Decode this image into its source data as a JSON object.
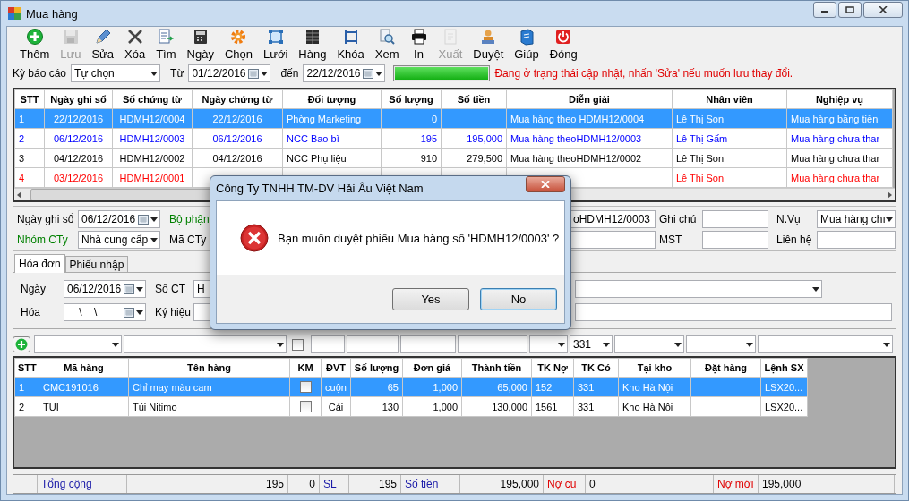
{
  "window": {
    "title": "Mua hàng"
  },
  "toolbar": [
    {
      "kind": "add",
      "label": "Thêm",
      "disabled": false
    },
    {
      "kind": "save",
      "label": "Lưu",
      "disabled": true
    },
    {
      "kind": "edit",
      "label": "Sửa",
      "disabled": false
    },
    {
      "kind": "delete",
      "label": "Xóa",
      "disabled": false
    },
    {
      "kind": "find",
      "label": "Tìm",
      "disabled": false
    },
    {
      "kind": "date",
      "label": "Ngày",
      "disabled": false
    },
    {
      "kind": "select",
      "label": "Chọn",
      "disabled": false
    },
    {
      "kind": "grid",
      "label": "Lưới",
      "disabled": false
    },
    {
      "kind": "items",
      "label": "Hàng",
      "disabled": false
    },
    {
      "kind": "lock",
      "label": "Khóa",
      "disabled": false
    },
    {
      "kind": "view",
      "label": "Xem",
      "disabled": false
    },
    {
      "kind": "print",
      "label": "In",
      "disabled": false
    },
    {
      "kind": "export",
      "label": "Xuất",
      "disabled": true
    },
    {
      "kind": "approve",
      "label": "Duyệt",
      "disabled": false
    },
    {
      "kind": "help",
      "label": "Giúp",
      "disabled": false
    },
    {
      "kind": "close",
      "label": "Đóng",
      "disabled": false
    }
  ],
  "filter": {
    "period_label": "Kỳ báo cáo",
    "period": "Tự chọn",
    "from_label": "Từ",
    "from": "01/12/2016",
    "to_label": "đến",
    "to": "22/12/2016",
    "progress": {
      "level": 1
    },
    "status_message": "Đang ở trạng thái cập nhật, nhấn 'Sửa' nếu muốn lưu thay đổi."
  },
  "documents": {
    "columns": [
      "STT",
      "Ngày ghi sổ",
      "Số chứng từ",
      "Ngày chứng từ",
      "Đối tượng",
      "Số lượng",
      "Số tiền",
      "Diễn giải",
      "Nhân viên",
      "Nghiệp vụ"
    ],
    "rows": [
      {
        "selected": true,
        "cells": [
          "1",
          "22/12/2016",
          "HDMH12/0004",
          "22/12/2016",
          "Phòng Marketing",
          "0",
          null,
          "Mua hàng theo HDMH12/0004",
          "Lê Thị Son",
          "Mua hàng bằng tiền"
        ]
      },
      {
        "selected": false,
        "color": "#0000ff",
        "cells": [
          "2",
          "06/12/2016",
          "HDMH12/0003",
          "06/12/2016",
          "NCC Bao bì",
          "195",
          "195,000",
          "Mua hàng theoHDMH12/0003",
          "Lê Thị Gấm",
          "Mua hàng chưa thar"
        ]
      },
      {
        "selected": false,
        "color": "#000000",
        "cells": [
          "3",
          "04/12/2016",
          "HDMH12/0002",
          "04/12/2016",
          "NCC Phụ liệu",
          "910",
          "279,500",
          "Mua hàng theoHDMH12/0002",
          "Lê Thị Son",
          "Mua hàng chưa thar"
        ]
      },
      {
        "selected": false,
        "color": "#ff0000",
        "cells": [
          "4",
          "03/12/2016",
          "HDMH12/0001",
          null,
          null,
          null,
          null,
          null,
          "Lê Thị Son",
          "Mua hàng chưa thar"
        ]
      }
    ]
  },
  "form": {
    "rows": [
      [
        {
          "kind": "label",
          "text": "Ngày ghi sổ",
          "color": "#000000"
        },
        {
          "kind": "date",
          "value": "06/12/2016"
        },
        {
          "kind": "label",
          "text": "Bộ phận",
          "color": "#008000"
        },
        {
          "kind": "field",
          "value": "oHDMH12/0003"
        },
        {
          "kind": "label",
          "text": "Ghi chú",
          "color": "#000000"
        },
        {
          "kind": "field"
        },
        {
          "kind": "label",
          "text": "N.Vụ",
          "color": "#000000"
        },
        {
          "kind": "combo",
          "value": "Mua hàng chı"
        }
      ],
      [
        {
          "kind": "label",
          "text": "Nhóm CTy",
          "color": "#008000"
        },
        {
          "kind": "combo",
          "value": "Nhà cung cấp"
        },
        {
          "kind": "label",
          "text": "Mã CTy",
          "color": "#000000"
        },
        {
          "kind": "field"
        },
        {
          "kind": "label",
          "text": "MST",
          "color": "#000000"
        },
        {
          "kind": "field"
        },
        {
          "kind": "label",
          "text": "Liên hệ",
          "color": "#000000"
        },
        {
          "kind": "field"
        }
      ]
    ]
  },
  "tabs": [
    {
      "label": "Hóa đơn",
      "selected": true
    },
    {
      "label": "Phiếu nhập",
      "selected": false
    }
  ],
  "invoice": {
    "rows": [
      [
        {
          "kind": "label",
          "text": "Ngày",
          "color": "#000000"
        },
        {
          "kind": "date",
          "value": "06/12/2016"
        },
        {
          "kind": "label",
          "text": "Số CT",
          "color": "#000000"
        },
        {
          "kind": "field",
          "value": "H"
        },
        {
          "kind": "combo"
        }
      ],
      [
        {
          "kind": "label",
          "text": "Hóa",
          "color": "#000000"
        },
        {
          "kind": "date",
          "value": "__\\__\\____"
        },
        {
          "kind": "label",
          "text": "Ký hiệu",
          "color": "#000000"
        },
        {
          "kind": "field"
        },
        {
          "kind": "field"
        }
      ]
    ]
  },
  "entry": {
    "checked": false,
    "account": "331"
  },
  "lines": {
    "columns": [
      "STT",
      "Mã hàng",
      "Tên hàng",
      "KM",
      "ĐVT",
      "Số lượng",
      "Đơn giá",
      "Thành tiền",
      "TK Nợ",
      "TK Có",
      "Tại kho",
      "Đặt hàng",
      "Lệnh SX"
    ],
    "rows": [
      {
        "selected": true,
        "km": false,
        "cells": [
          "1",
          "CMC191016",
          "Chỉ may màu cam",
          null,
          "cuộn",
          "65",
          "1,000",
          "65,000",
          "152",
          "331",
          "Kho Hà Nội",
          null,
          "LSX20..."
        ]
      },
      {
        "selected": false,
        "km": false,
        "cells": [
          "2",
          "TUI",
          "Túi Nitimo",
          null,
          "Cái",
          "130",
          "1,000",
          "130,000",
          "1561",
          "331",
          "Kho Hà Nội",
          null,
          "LSX20..."
        ]
      }
    ]
  },
  "totals": [
    {
      "text": "Tổng cộng",
      "color": "#1a1aa8"
    },
    {
      "text": "195"
    },
    {
      "text": "0"
    },
    {
      "text": "SL",
      "color": "#1a1aa8"
    },
    {
      "text": "195"
    },
    {
      "text": "Số tiền",
      "color": "#1a1aa8"
    },
    {
      "text": "195,000"
    },
    {
      "text": "Nợ cũ",
      "color": "#e00000"
    },
    {
      "text": "0"
    },
    {
      "text": "Nợ mới",
      "color": "#e00000"
    },
    {
      "text": "195,000"
    }
  ],
  "dialog": {
    "title": "Công Ty TNHH TM-DV Hải Âu Việt Nam",
    "message": "Bạn muốn duyệt phiếu Mua hàng số 'HDMH12/0003' ?",
    "buttons": [
      {
        "label": "Yes",
        "default": false
      },
      {
        "label": "No",
        "default": true
      }
    ]
  }
}
